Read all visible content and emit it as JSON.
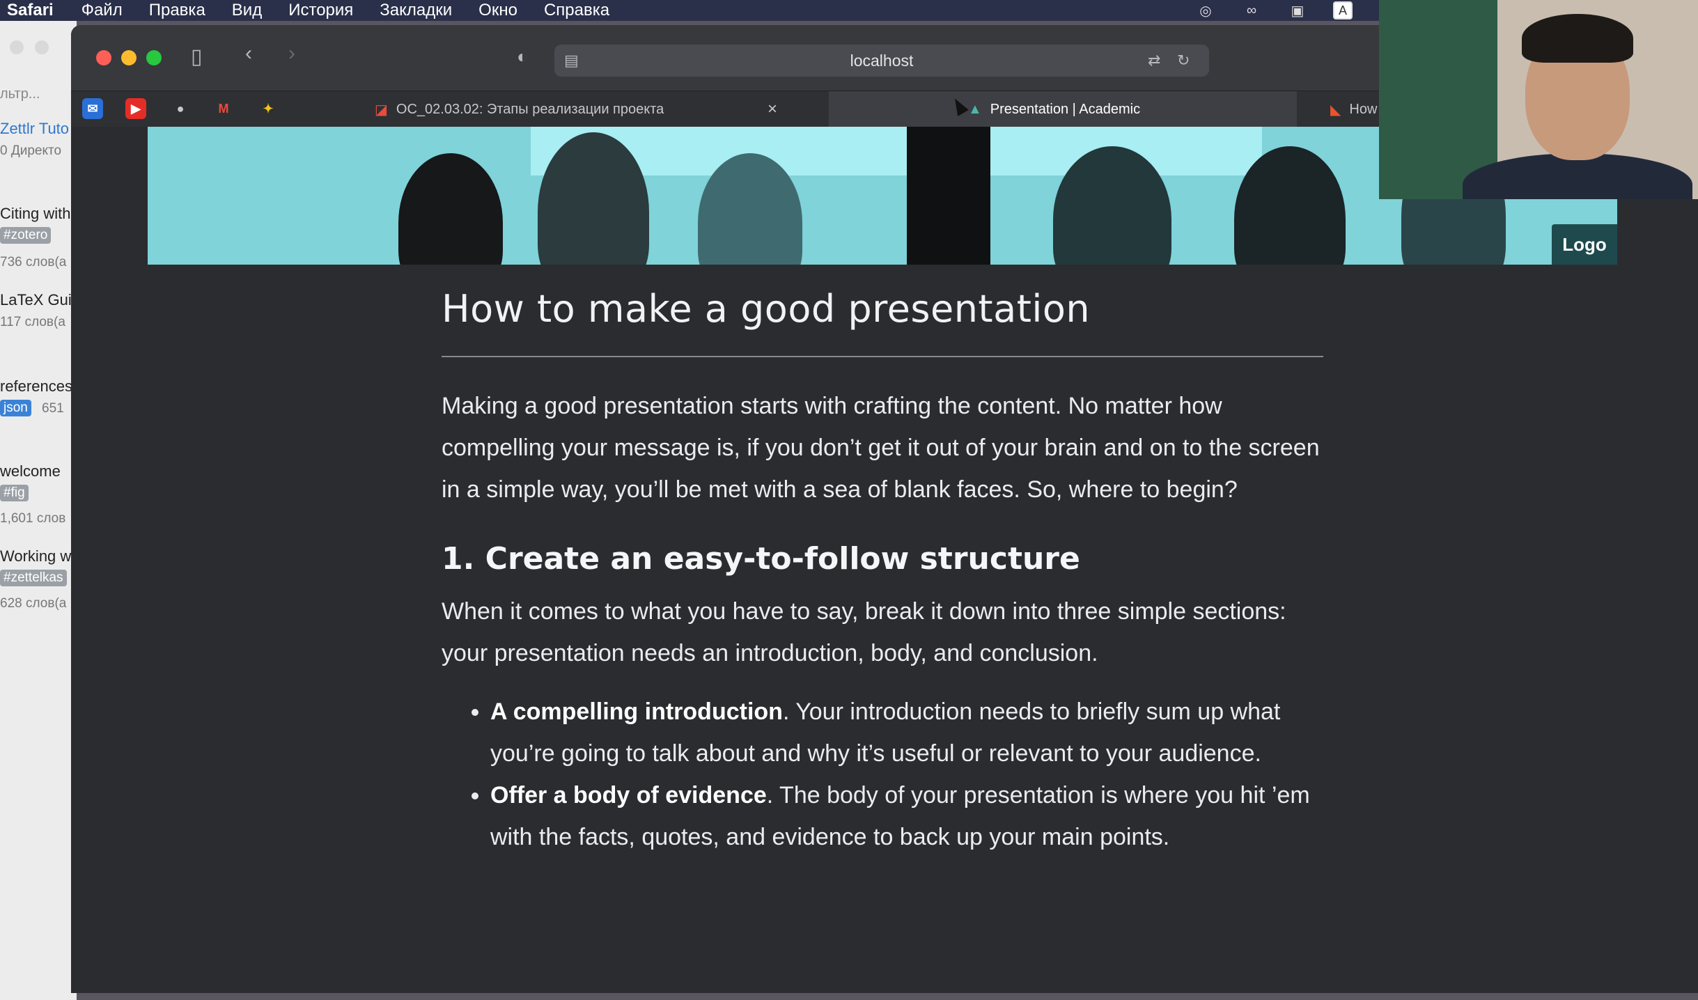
{
  "menubar": {
    "app": "Safari",
    "items": [
      "Файл",
      "Правка",
      "Вид",
      "История",
      "Закладки",
      "Окно",
      "Справка"
    ],
    "tray_letter": "A"
  },
  "background_app": {
    "filter_placeholder": "льтр...",
    "items": [
      {
        "title": "Zettlr Tuto",
        "meta": "0 Директо"
      },
      {
        "title": "Citing with",
        "tag": "#zotero",
        "meta": "736 слов(а"
      },
      {
        "title": "LaTeX Guid",
        "meta": "117 слов(а"
      },
      {
        "title": "references",
        "tag": "json",
        "meta": "651"
      },
      {
        "title": "welcome",
        "tag": "#fig",
        "meta": "1,601 слов"
      },
      {
        "title": "Working w",
        "tag": "#zettelkas",
        "meta": "628 слов(а"
      }
    ]
  },
  "browser": {
    "url": "localhost",
    "tabs": [
      {
        "label": "ОС_02.03.02: Этапы реализации проекта",
        "active": false
      },
      {
        "label": "Presentation | Academic",
        "active": true
      },
      {
        "label": "How To Make A",
        "active": false
      }
    ],
    "close_glyph": "×"
  },
  "page": {
    "logo_label": "Logo",
    "title": "How to make a good presentation",
    "intro": "Making a good presentation starts with crafting the content. No matter how compelling your message is, if you don’t get it out of your brain and on to the screen in a simple way, you’ll be met with a sea of blank faces. So, where to begin?",
    "section1_heading": "1. Create an easy-to-follow structure",
    "section1_text": "When it comes to what you have to say, break it down into three simple sections: your presentation needs an introduction, body, and conclusion.",
    "bullets": [
      {
        "bold": "A compelling introduction",
        "text": ". Your introduction needs to briefly sum up what you’re going to talk about and why it’s useful or relevant to your audience."
      },
      {
        "bold": "Offer a body of evidence",
        "text": ". The body of your presentation is where you hit ’em with the facts, quotes, and evidence to back up your main points."
      }
    ]
  },
  "colors": {
    "window_bg": "#2b2c30",
    "hero_bg": "#7fd3d9",
    "logo_bg": "#1f4a4d",
    "close_red": "#ff5f57",
    "min_yellow": "#febc2e",
    "max_green": "#28c840"
  }
}
